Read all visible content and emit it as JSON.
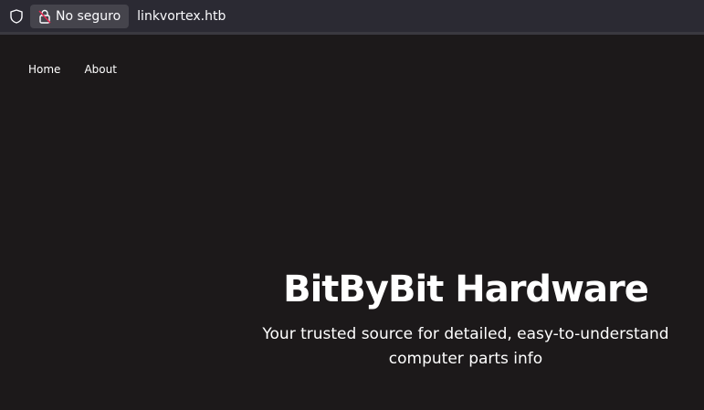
{
  "browser": {
    "security_label": "No seguro",
    "url": "linkvortex.htb",
    "icons": {
      "tracking": "shield-icon",
      "security": "insecure-lock-icon"
    },
    "colors": {
      "toolbar": "#2b2a33",
      "badge": "#45444c",
      "lock_strike": "#e22850"
    }
  },
  "site": {
    "nav": [
      {
        "label": "Home"
      },
      {
        "label": "About"
      }
    ],
    "hero": {
      "title": "BitByBit Hardware",
      "subtitle": "Your trusted source for detailed, easy-to-understand computer parts info"
    },
    "colors": {
      "background": "#1c191a",
      "text": "#ffffff"
    }
  }
}
